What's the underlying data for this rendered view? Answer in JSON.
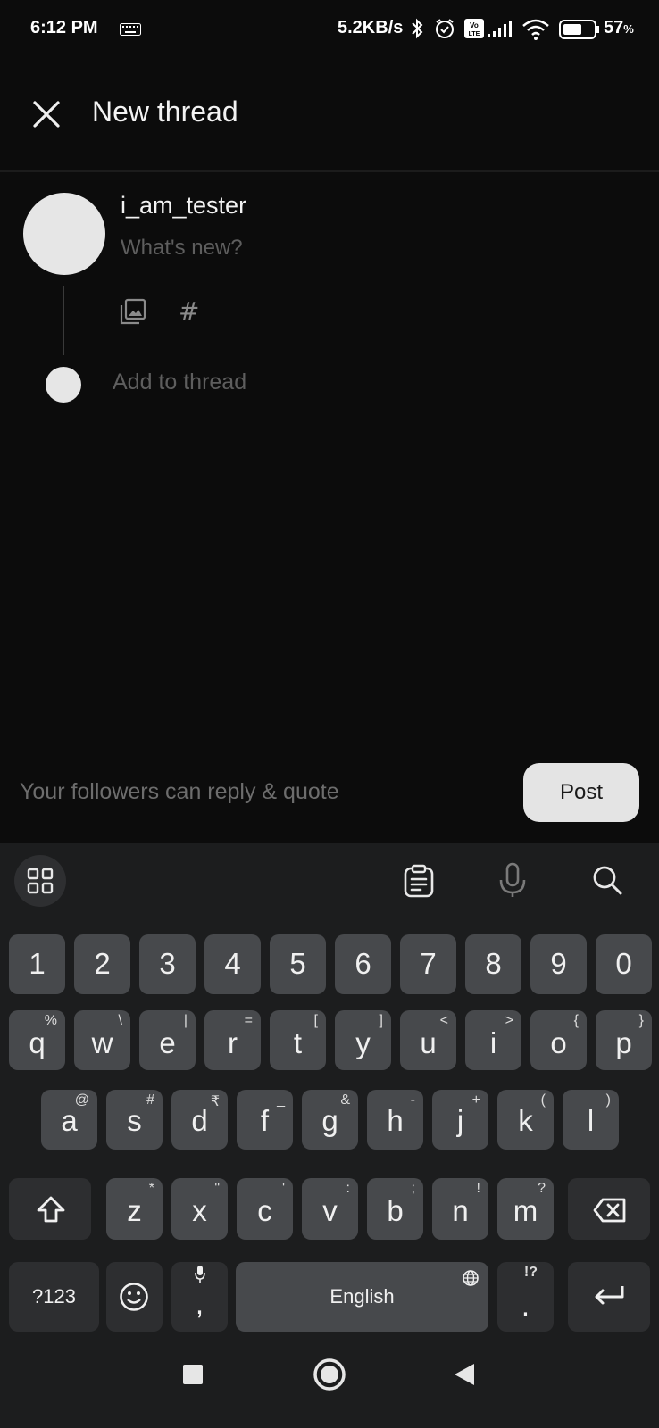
{
  "status_bar": {
    "time": "6:12 PM",
    "net_speed": "5.2KB/s",
    "battery_percent": "57",
    "battery_unit": "%",
    "icons": [
      "keyboard-icon",
      "bluetooth-icon",
      "alarm-icon",
      "volte-icon",
      "signal-icon",
      "wifi-icon",
      "battery-icon"
    ]
  },
  "header": {
    "title": "New thread",
    "close_icon": "close-icon"
  },
  "composer": {
    "username": "i_am_tester",
    "placeholder": "What's new?",
    "add_to_thread": "Add to thread",
    "attach_icons": [
      "image-gallery-icon",
      "hashtag-icon"
    ],
    "hash_glyph": "#"
  },
  "footer": {
    "reply_permission": "Your followers can reply & quote",
    "post_label": "Post"
  },
  "keyboard": {
    "toolbar_icons": [
      "apps-grid-icon",
      "clipboard-icon",
      "microphone-icon",
      "search-icon"
    ],
    "row_numbers": [
      "1",
      "2",
      "3",
      "4",
      "5",
      "6",
      "7",
      "8",
      "9",
      "0"
    ],
    "row1": [
      {
        "k": "q",
        "h": "%"
      },
      {
        "k": "w",
        "h": "\\"
      },
      {
        "k": "e",
        "h": "|"
      },
      {
        "k": "r",
        "h": "="
      },
      {
        "k": "t",
        "h": "["
      },
      {
        "k": "y",
        "h": "]"
      },
      {
        "k": "u",
        "h": "<"
      },
      {
        "k": "i",
        "h": ">"
      },
      {
        "k": "o",
        "h": "{"
      },
      {
        "k": "p",
        "h": "}"
      }
    ],
    "row2": [
      {
        "k": "a",
        "h": "@"
      },
      {
        "k": "s",
        "h": "#"
      },
      {
        "k": "d",
        "h": "₹"
      },
      {
        "k": "f",
        "h": "_"
      },
      {
        "k": "g",
        "h": "&"
      },
      {
        "k": "h",
        "h": "-"
      },
      {
        "k": "j",
        "h": "+"
      },
      {
        "k": "k",
        "h": "("
      },
      {
        "k": "l",
        "h": ")"
      }
    ],
    "row3": [
      {
        "k": "z",
        "h": "*"
      },
      {
        "k": "x",
        "h": "\""
      },
      {
        "k": "c",
        "h": "'"
      },
      {
        "k": "v",
        "h": ":"
      },
      {
        "k": "b",
        "h": ";"
      },
      {
        "k": "n",
        "h": "!"
      },
      {
        "k": "m",
        "h": "?"
      }
    ],
    "symbols_label": "?123",
    "comma": ",",
    "space_label": "English",
    "period": ".",
    "period_hint": "!?",
    "accent_color": "#47494c"
  },
  "nav_bar": {
    "icons": [
      "recents-square-icon",
      "home-circle-icon",
      "back-triangle-icon"
    ]
  }
}
